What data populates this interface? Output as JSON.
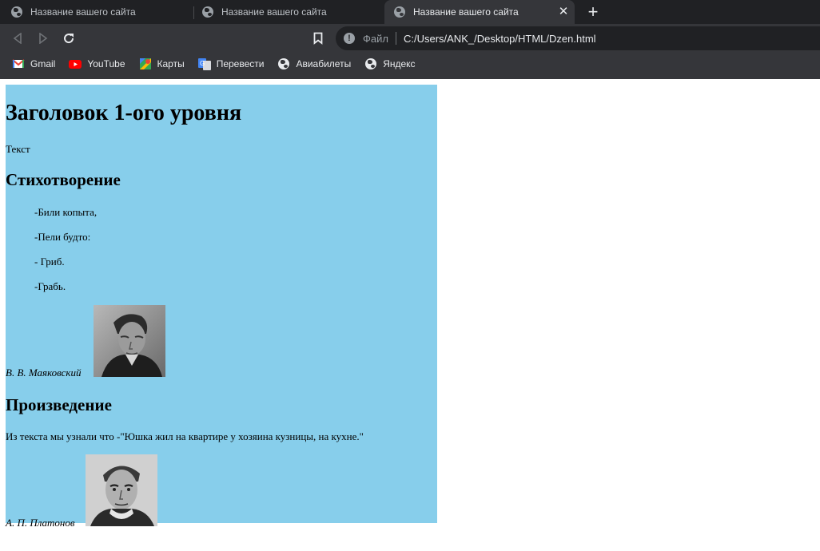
{
  "browser": {
    "tabs": [
      {
        "title": "Название вашего сайта"
      },
      {
        "title": "Название вашего сайта"
      },
      {
        "title": "Название вашего сайта"
      }
    ],
    "close_glyph": "✕",
    "newtab_glyph": "+",
    "omnibox": {
      "label": "Файл",
      "url": "C:/Users/ANK_/Desktop/HTML/Dzen.html"
    },
    "bookmarks": [
      {
        "label": "Gmail",
        "icon": "gmail-icon"
      },
      {
        "label": "YouTube",
        "icon": "youtube-icon"
      },
      {
        "label": "Карты",
        "icon": "maps-icon"
      },
      {
        "label": "Перевести",
        "icon": "translate-icon"
      },
      {
        "label": "Авиабилеты",
        "icon": "globe-icon"
      },
      {
        "label": "Яндекс",
        "icon": "globe-icon"
      }
    ],
    "colors": {
      "tabstrip": "#202124",
      "toolbar": "#35363a",
      "omnibox": "#202124"
    }
  },
  "page": {
    "background": "#87ceeb",
    "h1": "Заголовок 1-ого уровня",
    "text": "Текст",
    "poem": {
      "heading": "Стихотворение",
      "lines": [
        "-Били копыта,",
        "-Пели будто:",
        "- Гриб.",
        "-Грабь."
      ],
      "author": "В. В. Маяковский"
    },
    "work": {
      "heading": "Произведение",
      "text": "Из текста мы узнали что -\"Юшка жил на квартире у хозяина кузницы, на кухне.\"",
      "author": "А. П. Платонов"
    }
  }
}
